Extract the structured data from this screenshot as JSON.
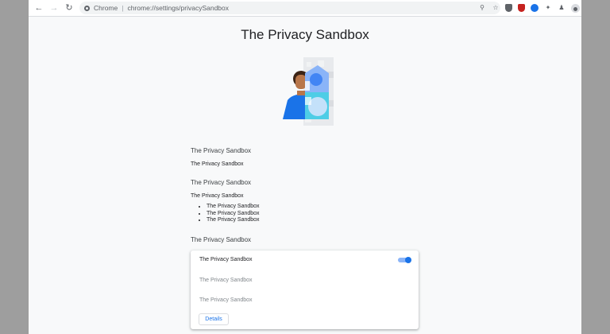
{
  "browser": {
    "site_label": "Chrome",
    "url": "chrome://settings/privacySandbox",
    "icons": [
      "back-icon",
      "forward-icon",
      "reload-icon",
      "site-info-icon",
      "zoom-icon",
      "star-icon",
      "extension-shield-icon",
      "extension-adblock-icon",
      "extension-circle-icon",
      "puzzle-icon",
      "person-icon",
      "profile-avatar-icon",
      "more-menu-icon"
    ]
  },
  "page": {
    "title": "The Privacy Sandbox",
    "section1": {
      "heading": "The Privacy Sandbox",
      "body": "The Privacy Sandbox"
    },
    "section2": {
      "heading": "The Privacy Sandbox",
      "body": "The Privacy Sandbox",
      "bullets": [
        "The Privacy Sandbox",
        "The Privacy Sandbox",
        "The Privacy Sandbox"
      ]
    },
    "section3": {
      "heading": "The Privacy Sandbox"
    },
    "card": {
      "toggle_label": "The Privacy Sandbox",
      "toggle_on": true,
      "row2": "The Privacy Sandbox",
      "row3": "The Privacy Sandbox",
      "details_label": "Details"
    }
  },
  "colors": {
    "accent": "#1a73e8",
    "page_bg": "#f8f9fa",
    "outer_bg": "#9e9e9e"
  }
}
